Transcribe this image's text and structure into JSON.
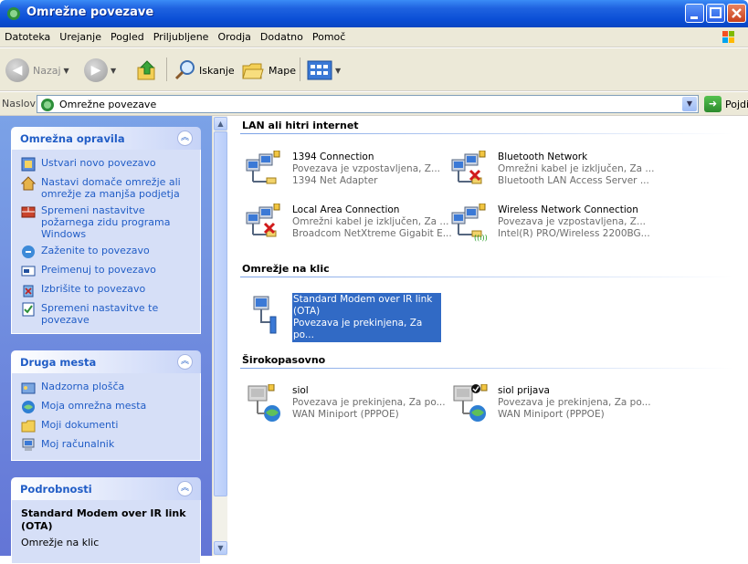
{
  "window": {
    "title": "Omrežne povezave"
  },
  "menu": [
    "Datoteka",
    "Urejanje",
    "Pogled",
    "Priljubljene",
    "Orodja",
    "Dodatno",
    "Pomoč"
  ],
  "toolbar": {
    "back": "Nazaj",
    "search": "Iskanje",
    "folders": "Mape"
  },
  "address": {
    "label": "Naslov",
    "value": "Omrežne povezave",
    "go": "Pojdi"
  },
  "sidebar": {
    "tasks": {
      "title": "Omrežna opravila",
      "items": [
        "Ustvari novo povezavo",
        "Nastavi domače omrežje ali omrežje za manjša podjetja",
        "Spremeni nastavitve požarnega zidu programa Windows",
        "Zaženite to povezavo",
        "Preimenuj to povezavo",
        "Izbrišite to povezavo",
        "Spremeni nastavitve te povezave"
      ]
    },
    "places": {
      "title": "Druga mesta",
      "items": [
        "Nadzorna plošča",
        "Moja omrežna mesta",
        "Moji dokumenti",
        "Moj računalnik"
      ]
    },
    "details": {
      "title": "Podrobnosti",
      "name": "Standard Modem over IR link (OTA)",
      "type": "Omrežje na klic"
    }
  },
  "groups": {
    "lan": {
      "title": "LAN ali hitri internet",
      "items": [
        {
          "name": "1394 Connection",
          "status": "Povezava je vzpostavljena, Z...",
          "device": "1394 Net Adapter"
        },
        {
          "name": "Bluetooth Network",
          "status": "Omrežni kabel je izključen, Za ...",
          "device": "Bluetooth LAN Access Server ..."
        },
        {
          "name": "Local Area Connection",
          "status": "Omrežni kabel je izključen, Za ...",
          "device": "Broadcom NetXtreme Gigabit E..."
        },
        {
          "name": "Wireless Network Connection",
          "status": "Povezava je vzpostavljena, Z...",
          "device": "Intel(R) PRO/Wireless 2200BG..."
        }
      ]
    },
    "dialup": {
      "title": "Omrežje na klic",
      "items": [
        {
          "name": "Standard Modem over IR link (OTA)",
          "status": "Povezava je prekinjena, Za po..."
        }
      ]
    },
    "broadband": {
      "title": "Širokopasovno",
      "items": [
        {
          "name": "siol",
          "status": "Povezava je prekinjena, Za po...",
          "device": "WAN Miniport (PPPOE)"
        },
        {
          "name": "siol prijava",
          "status": "Povezava je prekinjena, Za po...",
          "device": "WAN Miniport (PPPOE)"
        }
      ]
    }
  }
}
